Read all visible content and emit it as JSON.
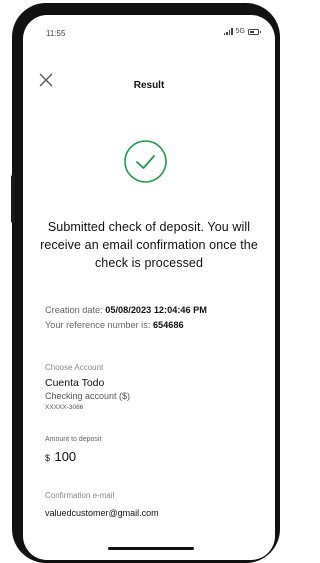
{
  "status_bar": {
    "time": "11:55",
    "network": "5G",
    "battery_level": 0.6
  },
  "header": {
    "title": "Result",
    "close_icon": "close-icon"
  },
  "success_icon": "check-circle-icon",
  "colors": {
    "success_green": "#1e9c46",
    "text_primary": "#111111",
    "text_secondary": "#666666"
  },
  "message": "Submitted check of deposit. You will receive an email confirmation once the check is processed",
  "details": {
    "creation_label": "Creation date:",
    "creation_value": "05/08/2023 12:04:46 PM",
    "reference_label": "Your reference number is:",
    "reference_value": "654686"
  },
  "account": {
    "label": "Choose Account",
    "name": "Cuenta Todo",
    "type": "Checking account ($)",
    "number": "XXXXX-3086"
  },
  "amount": {
    "label": "Amount to deposit",
    "currency": "$",
    "value": "100"
  },
  "email": {
    "label": "Confirmation e-mail",
    "value": "valuedcustomer@gmail.com"
  }
}
